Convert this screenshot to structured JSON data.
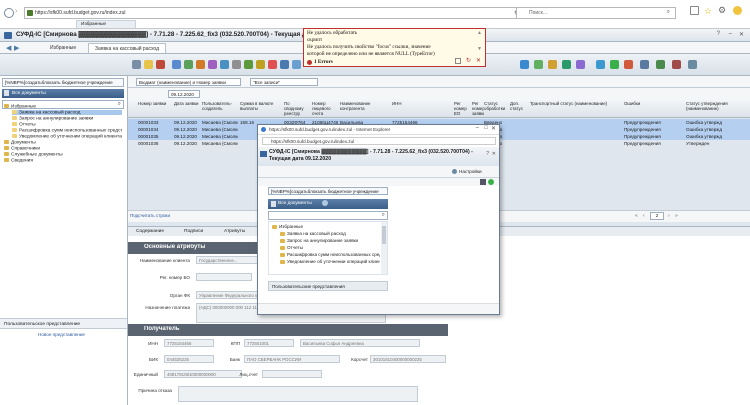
{
  "browser": {
    "url": "https://sfk00.sufd.budget.gov.ru/index.zul",
    "search_placeholder": "Поиск...",
    "tab_label": "Избранные"
  },
  "app": {
    "title": "СУФД-ІС [Смирнова ▓▓▓▓▓▓▓▓▓▓▓▓▓▓▓] - 7.71.28 - 7.225.62_fix3 (032.520.700Т04) - Текущая дата 09.12.2020"
  },
  "tabs": [
    {
      "label": "Избранные"
    },
    {
      "label": "Заявка на кассовый расход"
    }
  ],
  "toolbar": {
    "view_select": "Вюдмат (наименование) и Номер заявки",
    "filter_select": "\"Все записи\""
  },
  "left": {
    "org_select": "[%NBP%]создатьблокзать бюджетное учреждение",
    "docs_button": "Все документы",
    "tree": [
      {
        "label": "Избранные",
        "level": 0
      },
      {
        "label": "Заявка на кассовый расход",
        "level": 1,
        "selected": true
      },
      {
        "label": "Запрос на аннулирование заявки",
        "level": 1
      },
      {
        "label": "Отчеты",
        "level": 1
      },
      {
        "label": "Расшифровка сумм неиспользованных средств",
        "level": 1
      },
      {
        "label": "Уведомление об уточнении операций клиента",
        "level": 1
      },
      {
        "label": "Документы",
        "level": 0
      },
      {
        "label": "Справочники",
        "level": 0
      },
      {
        "label": "Служебные документы",
        "level": 0
      },
      {
        "label": "Сведения",
        "level": 0
      }
    ],
    "users_header": "Пользовательское представление",
    "users_link": "Новое представление"
  },
  "grid": {
    "date_filter": "09.12.2020",
    "columns": [
      "Номер заявки",
      "Дата заявки",
      "Пользователь-создатель",
      "Сумма в валюте выплаты",
      "По сводному реестру",
      "Номер лицевого счета",
      "Наименование контрагента",
      "ИНН",
      "Рег номер ЕО",
      "Рег номер заявки",
      "Статус обработки",
      "Доп. статус",
      "Транспортный статус (наименование)",
      "Ошибки",
      "Статус утверждения (наименование)"
    ],
    "rows": [
      {
        "num": "00001033",
        "date": "09.12.2020",
        "user": "Мисаева (Смолконтбюджет)",
        "sum": "168.16",
        "reg": "0032Ф764",
        "acc": "21086Ц47460",
        "agent": "Васильева",
        "inn": "7725154466",
        "status": "Введено",
        "err": "Предупреждения",
        "appr": "Ошибка утвержд",
        "sel": true
      },
      {
        "num": "00001034",
        "date": "09.12.2020",
        "user": "Мисаева (Смолконтбюджет)",
        "sum": "",
        "reg": "",
        "acc": "",
        "agent": "",
        "inn": "",
        "status": "Введено",
        "err": "Предупреждения",
        "appr": "Ошибка утвержд",
        "sel": true
      },
      {
        "num": "00001035",
        "date": "09.12.2020",
        "user": "Мисаева (Смолконтбюджет)",
        "sum": "",
        "reg": "",
        "acc": "",
        "agent": "",
        "inn": "",
        "status": "Введено",
        "err": "Предупреждения",
        "appr": "Ошибка утвержд",
        "sel": true
      },
      {
        "num": "00001036",
        "date": "09.12.2020",
        "user": "Мисаева (Смолконтбюджет)",
        "sum": "",
        "reg": "",
        "acc": "",
        "agent": "",
        "inn": "",
        "status": "Введено",
        "err": "Предупреждения",
        "appr": "Утвержден",
        "sel": false
      }
    ],
    "footer_link": "Подсчитать строки",
    "page": "2"
  },
  "form": {
    "tabs": [
      "Содержание",
      "Подписи",
      "Атрибуты"
    ],
    "basic_header": "Основные атрибуты",
    "client_label": "Наименование клиента",
    "client_value": "Государственное...",
    "regnum_label": "Рег. номер БО",
    "organ_label": "Орган ФК",
    "organ_value": "Управление Федерального казн...",
    "purpose_label": "Назначение платежа",
    "purpose_value": "(НДС) 000000000 000 112 1121 000 0000 000 000 000",
    "recipient_header": "Получатель",
    "inn_label": "ИНН",
    "inn_value": "7725154466",
    "kpp_label": "КПП",
    "kpp_value": "772501001",
    "name_value": "Васильева Софья Андреевна",
    "bik_label": "БИК",
    "bik_value": "044525225",
    "bank_label": "Банк",
    "bank_value": "ПАО СБЕРБАНК РОССИИ",
    "korr_label": "Корсчет",
    "korr_value": "30101810400000000225",
    "eks_label": "Единичный",
    "eks_value": "40817810810000000000",
    "ls_label": "Лиц.счет",
    "reason_label": "Причина отказа"
  },
  "popup": {
    "title": "https://sfk00.sufd.budget.gov.ru/index.zul - Internet Explorer",
    "url": "https://sfk00.sufd.budget.gov.ru/index.zul",
    "app_title": "СУФД-ІС [Смирнова ▓▓▓▓▓▓▓▓▓▓▓▓] - 7.71.28 - 7.225.62_fix3 (032.520.700Т04) - Текущая дата 09.12.2020",
    "settings": "Настройки",
    "org_select": "[%NBP%]создатьблокзать бюджетное учреждение",
    "docs_button": "Все документы",
    "tree": [
      {
        "label": "Избранные",
        "level": 0
      },
      {
        "label": "Заявка на кассовый расход",
        "level": 1
      },
      {
        "label": "Запрос на аннулирование заявки",
        "level": 1
      },
      {
        "label": "Отчеты",
        "level": 1
      },
      {
        "label": "Расшифровка сумм неиспользованных сред",
        "level": 1
      },
      {
        "label": "Уведомление об уточнении операций клиент",
        "level": 1
      }
    ],
    "users_header": "Пользовательские представления"
  },
  "error": {
    "line1": "Не удалось обработать",
    "line2": "скрипт",
    "line3": "Не удалось получить свойство \"focus\" ссылки, значение",
    "line4": "которой не определено или не является NULL (TypeError)",
    "count": "1 Errors"
  }
}
